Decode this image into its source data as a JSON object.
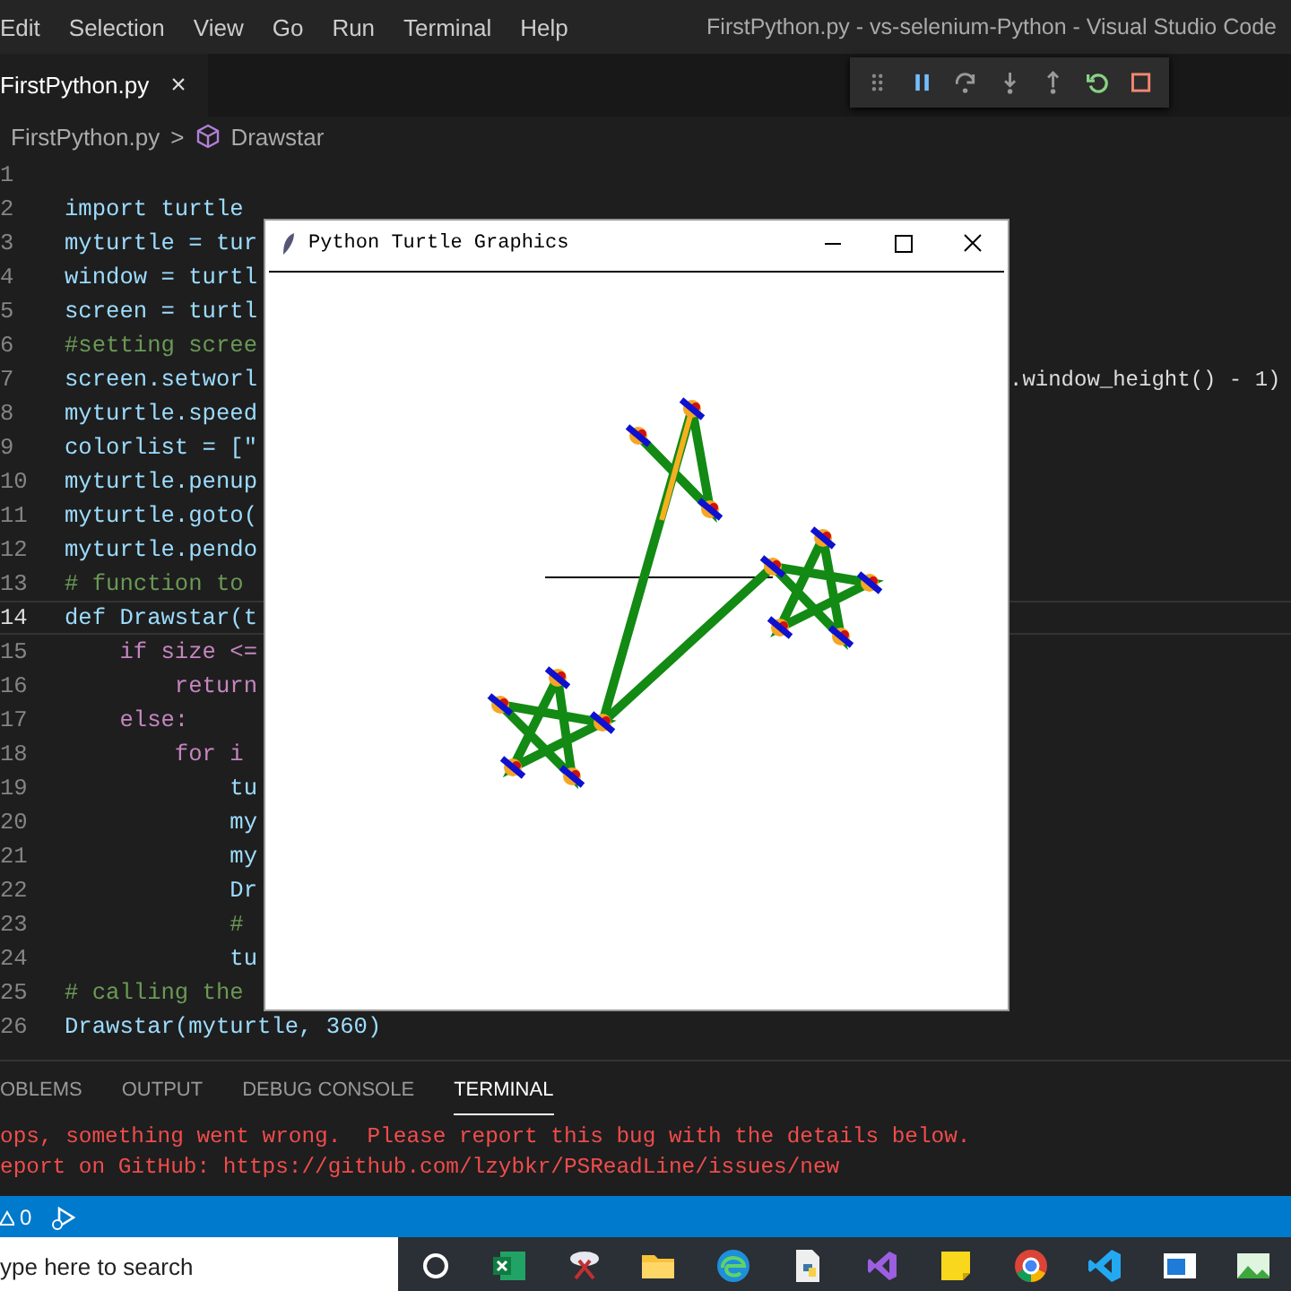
{
  "menu_bar": {
    "items": [
      "Edit",
      "Selection",
      "View",
      "Go",
      "Run",
      "Terminal",
      "Help"
    ],
    "title": "FirstPython.py - vs-selenium-Python - Visual Studio Code"
  },
  "tabs": [
    {
      "label": "FirstPython.py",
      "close": "×",
      "selected": true
    }
  ],
  "breadcrumb": {
    "file": "FirstPython.py",
    "separator": ">",
    "symbol": "Drawstar"
  },
  "editor": {
    "lines": [
      {
        "number": "1",
        "current": false
      },
      {
        "number": "2",
        "text": "import turtle",
        "kind": "code",
        "current": false
      },
      {
        "number": "3",
        "text": "myturtle = tur",
        "kind": "code",
        "current": false
      },
      {
        "number": "4",
        "text": "window = turtl",
        "kind": "code",
        "current": false
      },
      {
        "number": "5",
        "text": "screen = turtl",
        "kind": "code",
        "current": false
      },
      {
        "number": "6",
        "text": "#setting scree",
        "kind": "comment",
        "current": false
      },
      {
        "number": "7",
        "text": "screen.setworl",
        "text_right": ".window_height() - 1)",
        "kind": "code",
        "current": false
      },
      {
        "number": "8",
        "text": "myturtle.speed",
        "kind": "code",
        "current": false
      },
      {
        "number": "9",
        "text": "colorlist = [\"",
        "kind": "code",
        "current": false
      },
      {
        "number": "10",
        "text": "myturtle.penup",
        "kind": "code",
        "current": false
      },
      {
        "number": "11",
        "text": "myturtle.goto(",
        "kind": "code",
        "current": false
      },
      {
        "number": "12",
        "text": "myturtle.pendo",
        "kind": "code",
        "current": false
      },
      {
        "number": "13",
        "text": "# function to",
        "kind": "comment",
        "current": false
      },
      {
        "number": "14",
        "text": "def Drawstar(t",
        "kind": "code",
        "current": true
      },
      {
        "number": "15",
        "text": "    if size <=",
        "kind": "keyword",
        "current": false
      },
      {
        "number": "16",
        "text": "        return",
        "kind": "keyword",
        "current": false
      },
      {
        "number": "17",
        "text": "    else:",
        "kind": "keyword",
        "current": false
      },
      {
        "number": "18",
        "text": "        for i",
        "kind": "keyword",
        "current": false
      },
      {
        "number": "19",
        "text": "            tu",
        "kind": "code",
        "current": false
      },
      {
        "number": "20",
        "text": "            my",
        "kind": "code",
        "current": false
      },
      {
        "number": "21",
        "text": "            my",
        "kind": "code",
        "current": false
      },
      {
        "number": "22",
        "text": "            Dr",
        "kind": "code",
        "current": false
      },
      {
        "number": "23",
        "text": "            #",
        "kind": "comment",
        "current": false
      },
      {
        "number": "24",
        "text": "            tu",
        "kind": "code",
        "current": false
      },
      {
        "number": "25",
        "text": "# calling the",
        "kind": "comment",
        "current": false
      },
      {
        "number": "26",
        "text": "Drawstar(myturtle, 360)",
        "kind": "code",
        "current": false
      }
    ]
  },
  "turtle_window": {
    "title": "Python Turtle Graphics"
  },
  "panel": {
    "tabs": [
      {
        "label": "OBLEMS",
        "selected": false
      },
      {
        "label": "OUTPUT",
        "selected": false
      },
      {
        "label": "DEBUG CONSOLE",
        "selected": false
      },
      {
        "label": "TERMINAL",
        "selected": true
      }
    ],
    "terminal_lines": [
      "ops, something went wrong.  Please report this bug with the details below.",
      "eport on GitHub: https://github.com/lzybkr/PSReadLine/issues/new"
    ]
  },
  "status_bar": {
    "warnings": "0"
  },
  "taskbar": {
    "search": {
      "placeholder": "ype here to search"
    }
  }
}
